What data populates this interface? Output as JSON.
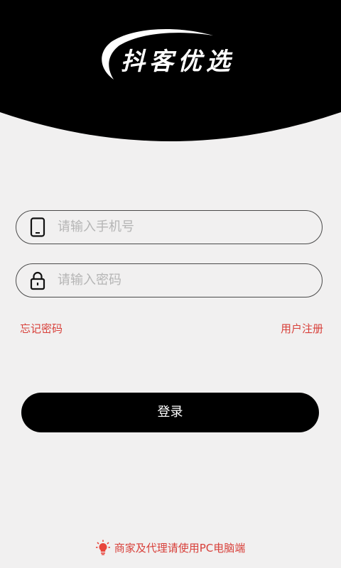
{
  "header": {
    "logo_text": "抖客优选"
  },
  "phone_field": {
    "placeholder": "请输入手机号",
    "value": ""
  },
  "password_field": {
    "placeholder": "请输入密码",
    "value": ""
  },
  "links": {
    "forgot_password": "忘记密码",
    "register": "用户注册"
  },
  "login_button": {
    "label": "登录"
  },
  "footer": {
    "note": "商家及代理请使用PC电脑端"
  },
  "colors": {
    "background": "#f1f0f0",
    "header": "#000000",
    "accent": "#d8403a",
    "button": "#000000"
  },
  "icons": {
    "phone": "phone-icon",
    "lock": "lock-icon",
    "bulb": "lightbulb-icon",
    "swoosh": "logo-swoosh"
  }
}
